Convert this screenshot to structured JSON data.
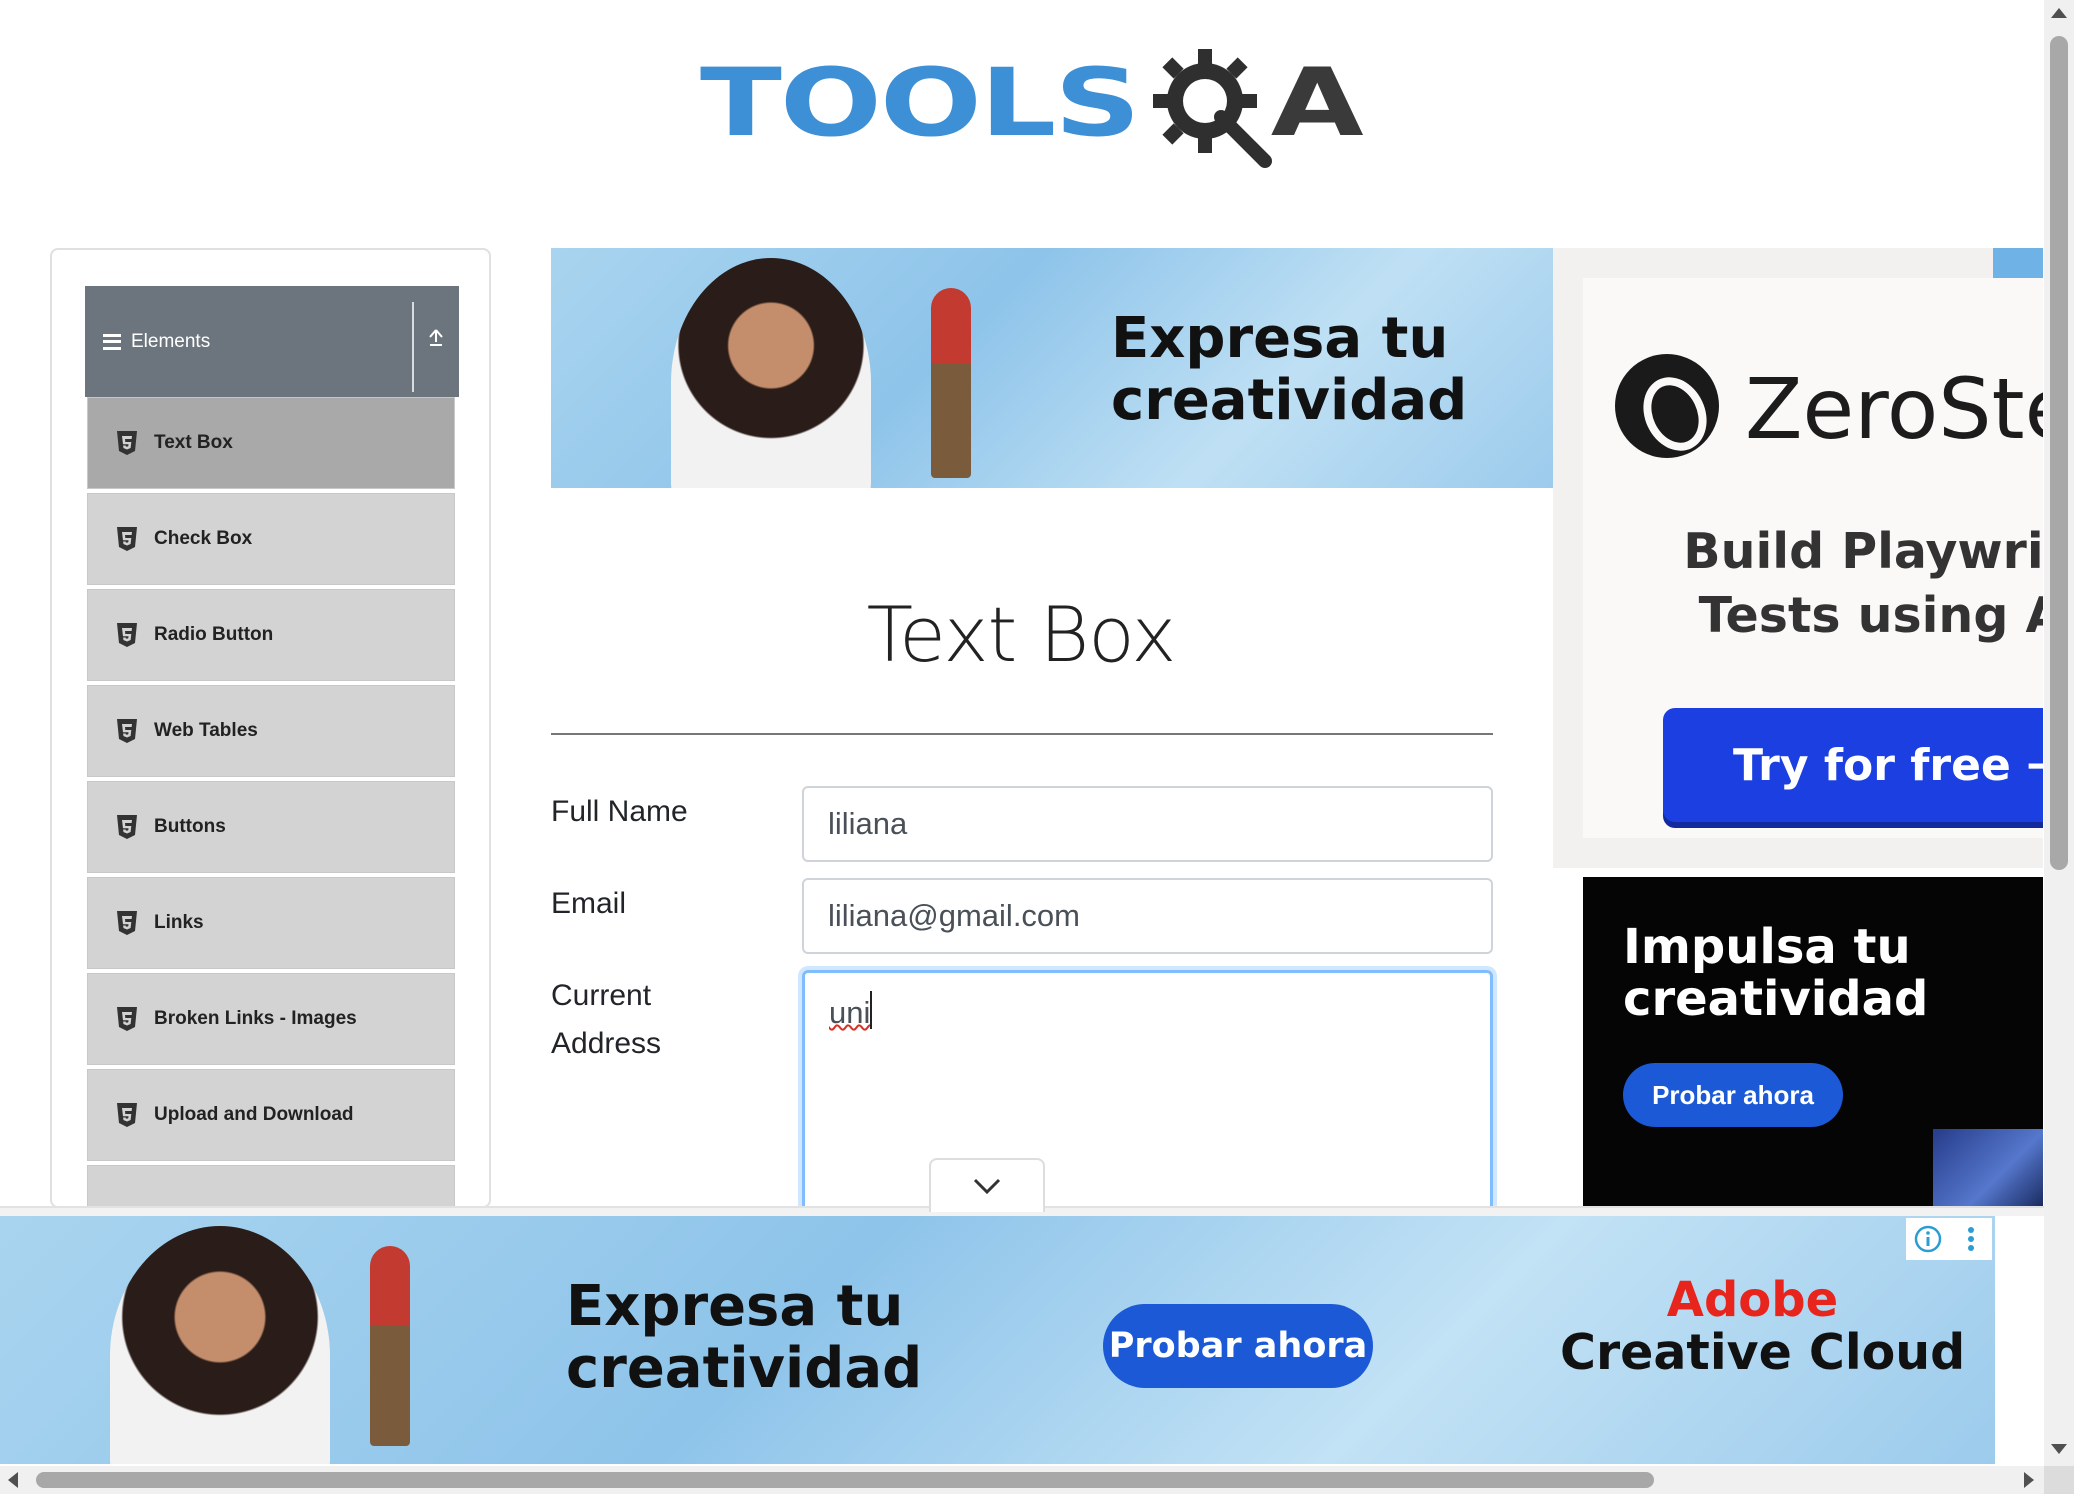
{
  "header": {
    "logo_text": "TOOLSQA",
    "logo_primary": "TOOLS",
    "logo_secondary": "A",
    "logo_color": "#3d8fd6"
  },
  "sidebar": {
    "group_title": "Elements",
    "items": [
      {
        "label": "Text Box",
        "active": true
      },
      {
        "label": "Check Box"
      },
      {
        "label": "Radio Button"
      },
      {
        "label": "Web Tables"
      },
      {
        "label": "Buttons"
      },
      {
        "label": "Links"
      },
      {
        "label": "Broken Links - Images"
      },
      {
        "label": "Upload and Download"
      }
    ]
  },
  "ads": {
    "top_banner": {
      "headline": "Expresa tu creatividad",
      "line1": "Expresa tu",
      "line2": "creatividad"
    },
    "right_top": {
      "brand": "ZeroSte",
      "tagline_1": "Build Playwrig",
      "tagline_2": "Tests using A",
      "button": "Try for free →"
    },
    "right_bottom": {
      "line1": "Impulsa tu",
      "line2": "creatividad",
      "button": "Probar ahora"
    },
    "bottom": {
      "line1": "Expresa tu",
      "line2": "creatividad",
      "button": "Probar ahora",
      "brand_1": "Adobe",
      "brand_2": "Creative Cloud"
    }
  },
  "form": {
    "title": "Text Box",
    "full_name": {
      "label": "Full Name",
      "value": "liliana"
    },
    "email": {
      "label": "Email",
      "value": "liliana@gmail.com"
    },
    "current_address": {
      "label_1": "Current",
      "label_2": "Address",
      "value": "uni"
    }
  },
  "colors": {
    "accent": "#1b59d6",
    "sidebar_header": "#6c757d",
    "focus_border": "#80bdff",
    "brand_red": "#e8251c"
  }
}
